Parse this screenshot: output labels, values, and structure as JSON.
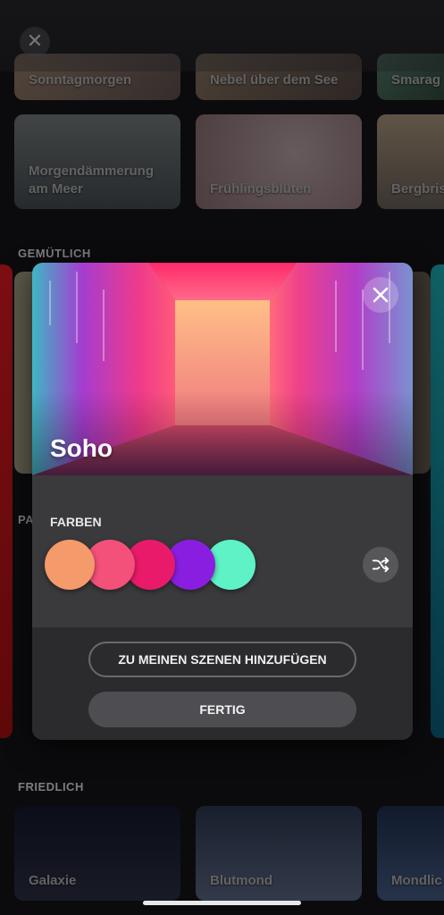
{
  "background": {
    "close_symbol": "✕",
    "rows": [
      {
        "tiles": [
          "Sonntagmorgen",
          "Nebel über dem See",
          "Smarag"
        ]
      },
      {
        "tiles": [
          "Morgendämmerung\nam Meer",
          "Frühlingsblüten",
          "Bergbris"
        ]
      }
    ],
    "sections": [
      {
        "title": "GEMÜTLICH"
      },
      {
        "title": "PA"
      },
      {
        "title": "FRIEDLICH"
      }
    ],
    "bottom_tiles": [
      "Galaxie",
      "Blutmond",
      "Mondlic"
    ]
  },
  "modal": {
    "title": "Soho",
    "colors_label": "FARBEN",
    "colors": [
      "#f59a6a",
      "#f3507a",
      "#ea1a6b",
      "#8a1ee0",
      "#5ef2c6"
    ],
    "add_button": "ZU MEINEN SZENEN HINZUFÜGEN",
    "done_button": "FERTIG",
    "close_icon": "close-icon",
    "shuffle_icon": "shuffle-icon"
  }
}
